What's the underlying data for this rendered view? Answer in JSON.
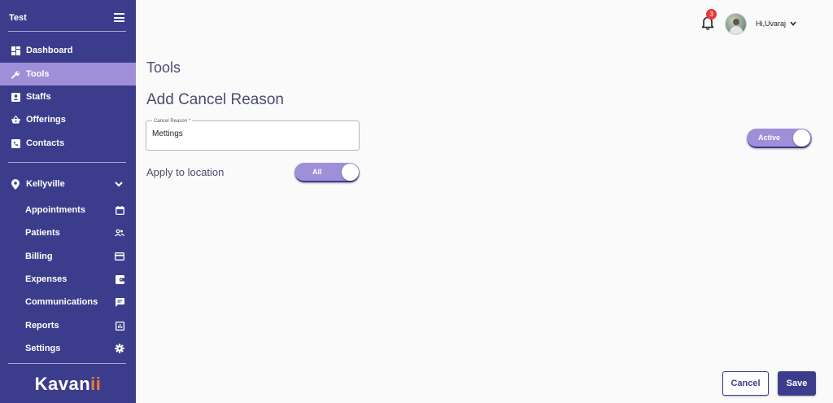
{
  "sidebar": {
    "title": "Test",
    "nav": [
      {
        "label": "Dashboard",
        "icon": "dashboard-icon",
        "active": false
      },
      {
        "label": "Tools",
        "icon": "wrench-icon",
        "active": true
      },
      {
        "label": "Staffs",
        "icon": "staff-badge-icon",
        "active": false
      },
      {
        "label": "Offerings",
        "icon": "basket-icon",
        "active": false
      },
      {
        "label": "Contacts",
        "icon": "phone-icon",
        "active": false
      }
    ],
    "location": {
      "label": "Kellyville",
      "icon": "location-pin-icon"
    },
    "location_items": [
      {
        "label": "Appointments",
        "icon": "calendar-icon"
      },
      {
        "label": "Patients",
        "icon": "people-icon"
      },
      {
        "label": "Billing",
        "icon": "credit-card-icon"
      },
      {
        "label": "Expenses",
        "icon": "wallet-icon"
      },
      {
        "label": "Communications",
        "icon": "chat-icon"
      },
      {
        "label": "Reports",
        "icon": "chart-icon"
      },
      {
        "label": "Settings",
        "icon": "gear-icon"
      }
    ],
    "brand_main": "Kavan",
    "brand_accent": "ii"
  },
  "header": {
    "notification_count": "3",
    "user_greeting": "Hi,Uvaraj"
  },
  "main": {
    "page_title": "Tools",
    "section_title": "Add Cancel Reason",
    "cancel_reason": {
      "label": "Cancel Reason *",
      "value": "Mettings"
    },
    "apply_label": "Apply to location",
    "apply_toggle": {
      "label": "All",
      "on": true
    },
    "status_toggle": {
      "label": "Active",
      "on": true
    },
    "cancel_button": "Cancel",
    "save_button": "Save"
  },
  "colors": {
    "sidebar_bg": "#3b3d8c",
    "active_bg": "#9f8fd8",
    "brand_accent": "#ef7a3a",
    "badge": "#e53935"
  }
}
